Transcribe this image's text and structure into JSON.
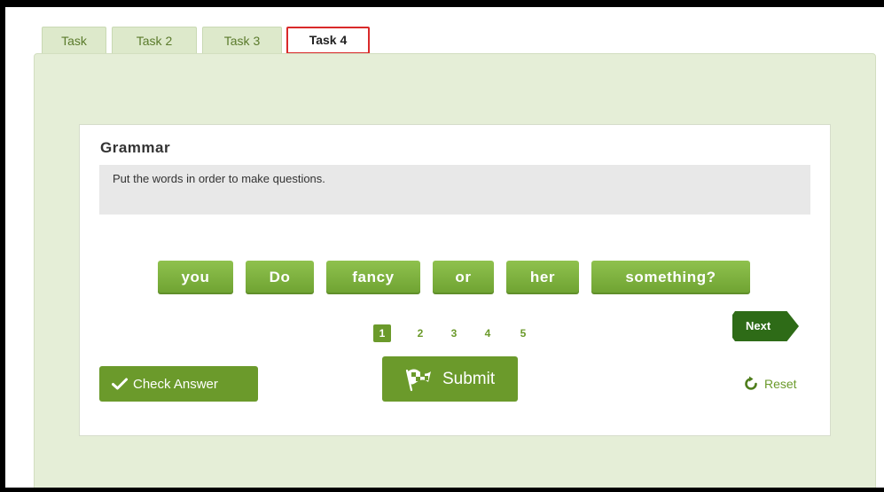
{
  "tabs": [
    {
      "label": "Task"
    },
    {
      "label": "Task 2"
    },
    {
      "label": "Task 3"
    },
    {
      "label": "Task 4",
      "active": true
    }
  ],
  "exercise": {
    "title": "Grammar",
    "instruction": "Put the words in order to make questions."
  },
  "word_tiles": [
    "you",
    "Do",
    "fancy",
    "or",
    "her",
    "something?"
  ],
  "pagination": {
    "pages": [
      "1",
      "2",
      "3",
      "4",
      "5"
    ],
    "current": "1"
  },
  "buttons": {
    "next": "Next",
    "check_answer": "Check Answer",
    "submit": "Submit",
    "reset": "Reset"
  },
  "icons": {
    "check_answer": "checkmark-icon",
    "submit": "checkered-flag-icon",
    "reset": "refresh-icon"
  },
  "colors": {
    "panel_background": "#e5eed7",
    "button_green": "#6b9a2b",
    "tile_green": "#7fb140",
    "next_dark_green": "#2e6b17",
    "active_tab_border": "#d92a2a"
  }
}
